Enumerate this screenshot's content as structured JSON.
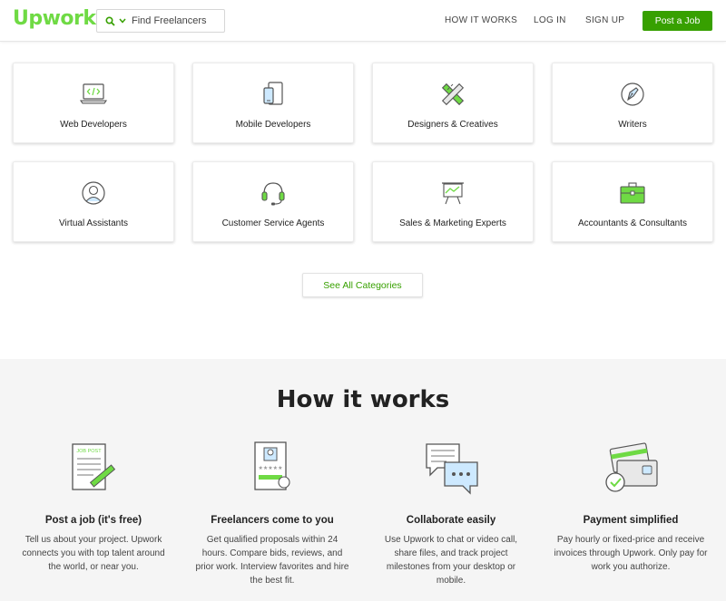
{
  "header": {
    "logo": "Upwork",
    "search_placeholder": "Find Freelancers",
    "nav": [
      "HOW IT WORKS",
      "LOG IN",
      "SIGN UP"
    ],
    "post_job": "Post a Job"
  },
  "categories": [
    {
      "label": "Web Developers",
      "icon": "code-laptop-icon"
    },
    {
      "label": "Mobile Developers",
      "icon": "mobile-devices-icon"
    },
    {
      "label": "Designers & Creatives",
      "icon": "pencil-ruler-icon"
    },
    {
      "label": "Writers",
      "icon": "pen-nib-icon"
    },
    {
      "label": "Virtual Assistants",
      "icon": "user-circle-icon"
    },
    {
      "label": "Customer Service Agents",
      "icon": "headset-icon"
    },
    {
      "label": "Sales & Marketing Experts",
      "icon": "presentation-chart-icon"
    },
    {
      "label": "Accountants & Consultants",
      "icon": "briefcase-icon"
    }
  ],
  "see_all": "See All Categories",
  "how_it_works": {
    "title": "How it works",
    "steps": [
      {
        "title": "Post a job (it's free)",
        "text": "Tell us about your project. Upwork connects you with top talent around the world, or near you.",
        "icon": "job-post-icon",
        "badge": "JOB POST"
      },
      {
        "title": "Freelancers come to you",
        "text": "Get qualified proposals within 24 hours. Compare bids, reviews, and prior work. Interview favorites and hire the best fit.",
        "icon": "freelancer-profile-icon"
      },
      {
        "title": "Collaborate easily",
        "text": "Use Upwork to chat or video call, share files, and track project milestones from your desktop or mobile.",
        "icon": "chat-bubbles-icon"
      },
      {
        "title": "Payment simplified",
        "text": "Pay hourly or fixed-price and receive invoices through Upwork. Only pay for work you authorize.",
        "icon": "payment-cards-icon"
      }
    ]
  },
  "colors": {
    "brand": "#6fda44",
    "accent": "#37a000"
  }
}
